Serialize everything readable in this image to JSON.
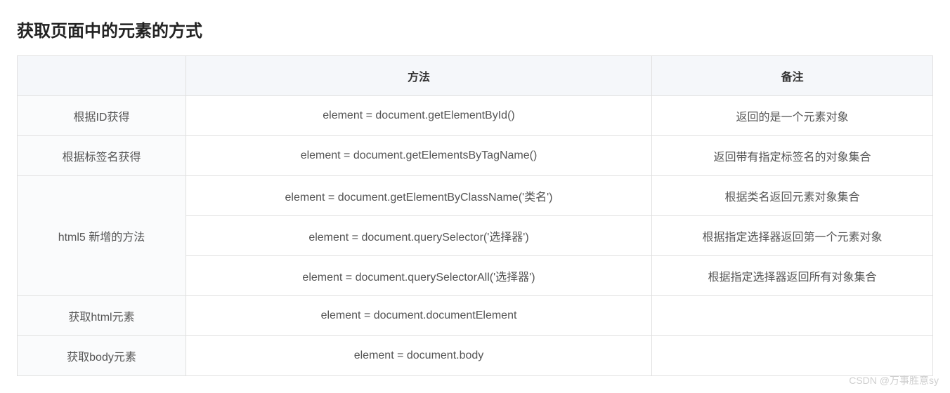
{
  "title": "获取页面中的元素的方式",
  "headers": {
    "col1": "",
    "col2": "方法",
    "col3": "备注"
  },
  "rows": [
    {
      "label": "根据ID获得",
      "methods": [
        "element = document.getElementById()"
      ],
      "notes": [
        "返回的是一个元素对象"
      ]
    },
    {
      "label": "根据标签名获得",
      "methods": [
        "element = document.getElementsByTagName()"
      ],
      "notes": [
        "返回带有指定标签名的对象集合"
      ]
    },
    {
      "label": "html5 新增的方法",
      "methods": [
        "element = document.getElementByClassName('类名')",
        "element = document.querySelector('选择器')",
        "element = document.querySelectorAll('选择器')"
      ],
      "notes": [
        "根据类名返回元素对象集合",
        "根据指定选择器返回第一个元素对象",
        "根据指定选择器返回所有对象集合"
      ]
    },
    {
      "label": "获取html元素",
      "methods": [
        "element = document.documentElement"
      ],
      "notes": [
        ""
      ]
    },
    {
      "label": "获取body元素",
      "methods": [
        "element = document.body"
      ],
      "notes": [
        ""
      ]
    }
  ],
  "watermark": "CSDN @万事胜意sy"
}
